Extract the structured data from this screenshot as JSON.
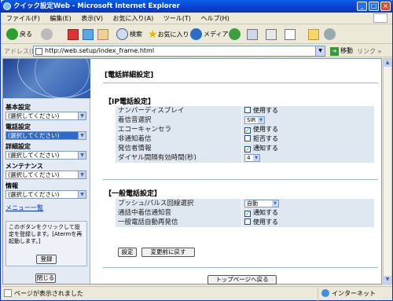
{
  "window": {
    "title": "クイック設定Web - Microsoft Internet Explorer"
  },
  "menubar": {
    "items": [
      "ファイル(F)",
      "編集(E)",
      "表示(V)",
      "お気に入り(A)",
      "ツール(T)",
      "ヘルプ(H)"
    ]
  },
  "toolbar": {
    "back": "戻る",
    "search": "検索",
    "favorites": "お気に入り",
    "media": "メディア"
  },
  "address": {
    "label": "アドレス(D)",
    "url": "http://web.setup/index_frame.html",
    "go": "移動",
    "links": "リンク"
  },
  "sidebar": {
    "sections": [
      {
        "label": "基本設定",
        "value": "(選択してください)",
        "highlight": false
      },
      {
        "label": "電話設定",
        "value": "(選択してください)",
        "highlight": true
      },
      {
        "label": "詳細設定",
        "value": "(選択してください)",
        "highlight": false
      },
      {
        "label": "メンテナンス",
        "value": "(選択してください)",
        "highlight": false
      },
      {
        "label": "情報",
        "value": "(選択してください)",
        "highlight": false
      }
    ],
    "menu_list": "メニュー一覧",
    "note": "このボタンをクリックして設定を登録します。[Atermを再起動します。]",
    "register": "登録",
    "close": "閉じる"
  },
  "main": {
    "title": "[電話詳細設定]",
    "ip_header": "【IP電話設定】",
    "ip_rows": [
      {
        "label": "ナンバーディスプレイ",
        "type": "checkbox",
        "checked": false,
        "text": "使用する"
      },
      {
        "label": "着信音選択",
        "type": "select",
        "text": "SIR"
      },
      {
        "label": "エコーキャンセラ",
        "type": "checkbox",
        "checked": true,
        "text": "使用する"
      },
      {
        "label": "非通知着信",
        "type": "checkbox",
        "checked": false,
        "text": "拒否する"
      },
      {
        "label": "発信者情報",
        "type": "checkbox",
        "checked": true,
        "text": "通知する"
      },
      {
        "label": "ダイヤル間隔有効時間(秒)",
        "type": "select",
        "text": "4"
      }
    ],
    "gen_header": "【一般電話設定】",
    "gen_rows": [
      {
        "label": "プッシュ/パルス回線選択",
        "type": "select",
        "text": "自動"
      },
      {
        "label": "通話中着信通知音",
        "type": "checkbox",
        "checked": true,
        "text": "通知する"
      },
      {
        "label": "一般電話自動再発信",
        "type": "checkbox",
        "checked": false,
        "text": "使用する"
      }
    ],
    "set_button": "設定",
    "reset_button": "変更前に戻す",
    "top_button": "トップページへ戻る"
  },
  "status": {
    "text": "ページが表示されました",
    "zone": "インターネット"
  },
  "colors": {
    "titlebar": "#0a3fcc",
    "panel": "#dfe7f1",
    "sidebar": "#e3eaf3",
    "highlight": "#316ac5"
  }
}
